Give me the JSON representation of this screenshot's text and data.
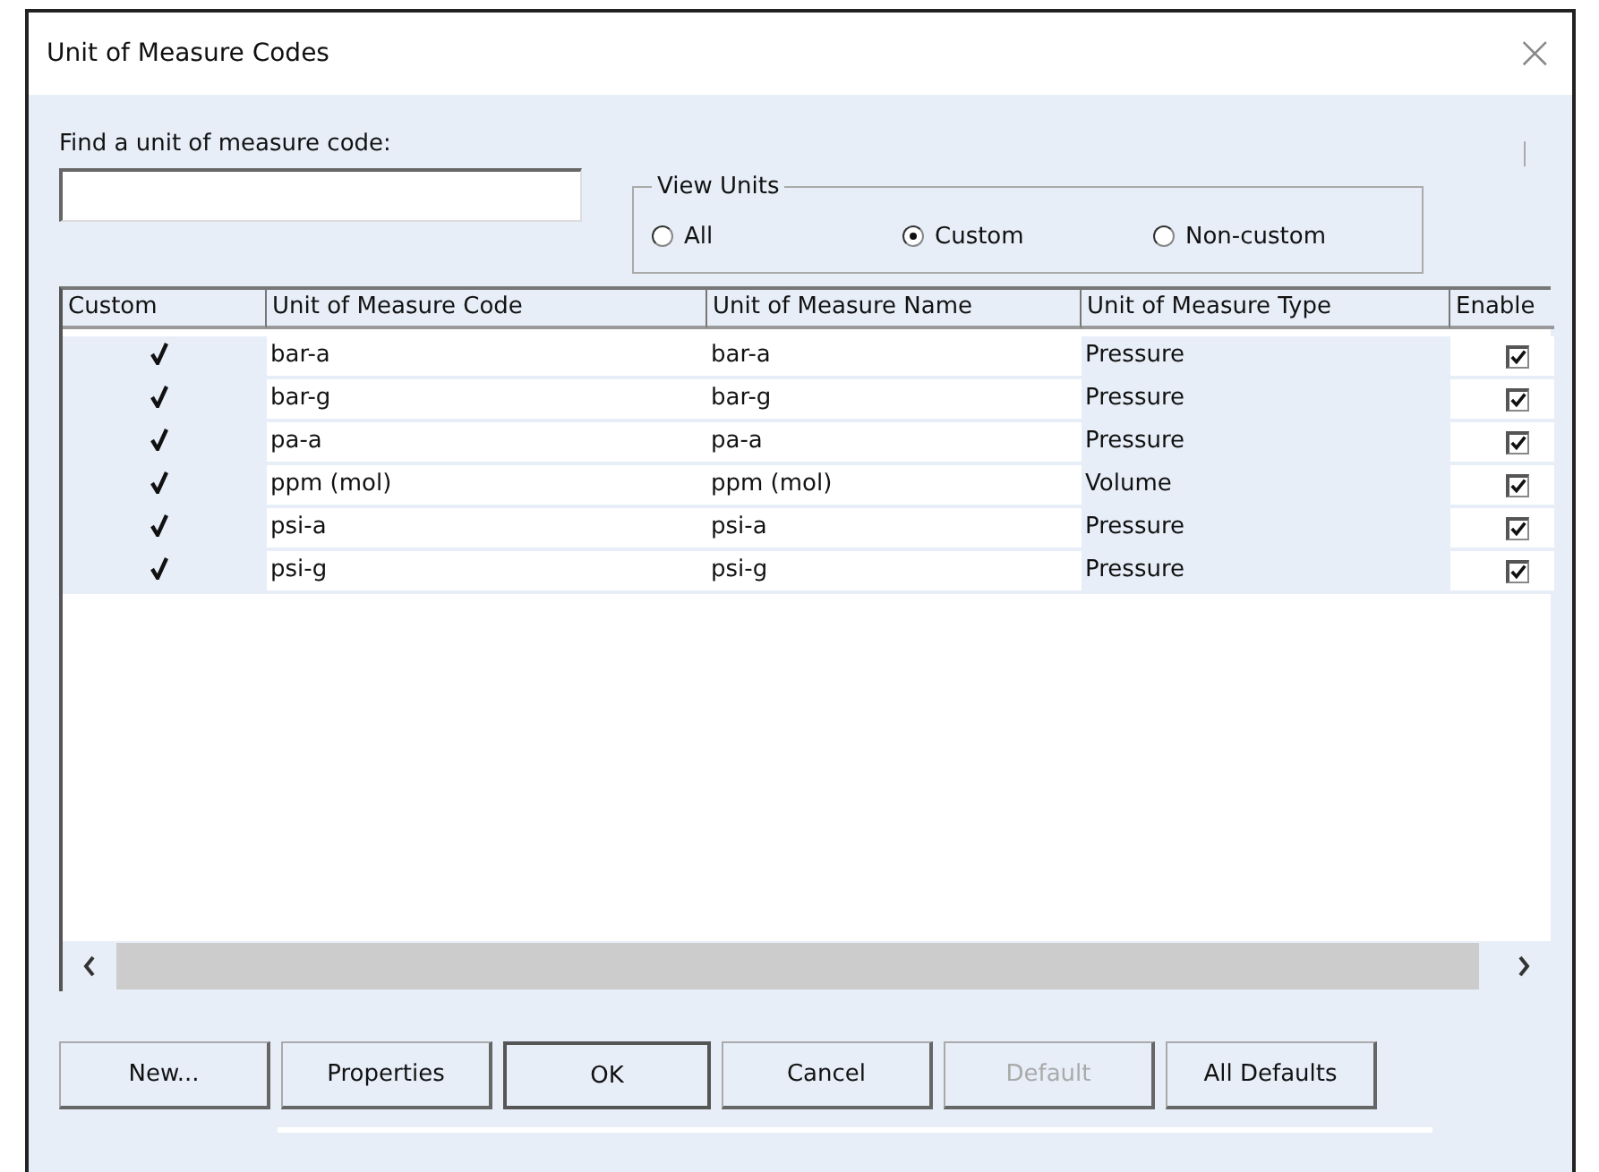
{
  "window": {
    "title": "Unit of Measure Codes",
    "close": "×"
  },
  "search": {
    "label": "Find a unit of measure code:"
  },
  "view_units": {
    "label": "View Units",
    "options": [
      {
        "label": "All",
        "selected": false
      },
      {
        "label": "Custom",
        "selected": true
      },
      {
        "label": "Non-custom",
        "selected": false
      }
    ]
  },
  "table": {
    "columns": [
      "Custom",
      "Unit of Measure Code",
      "Unit of Measure Name",
      "Unit of Measure Type",
      "Enable"
    ],
    "rows": [
      {
        "custom": true,
        "code": "bar-a",
        "name": "bar-a",
        "type": "Pressure",
        "enabled": true
      },
      {
        "custom": true,
        "code": "bar-g",
        "name": "bar-g",
        "type": "Pressure",
        "enabled": true
      },
      {
        "custom": true,
        "code": "pa-a",
        "name": "pa-a",
        "type": "Pressure",
        "enabled": true
      },
      {
        "custom": true,
        "code": "ppm (mol)",
        "name": "ppm (mol)",
        "type": "Volume",
        "enabled": true
      },
      {
        "custom": true,
        "code": "psi-a",
        "name": "psi-a",
        "type": "Pressure",
        "enabled": true
      },
      {
        "custom": true,
        "code": "psi-g",
        "name": "psi-g",
        "type": "Pressure",
        "enabled": true
      }
    ]
  },
  "buttons": [
    {
      "label": "New...",
      "disabled": false,
      "default": false
    },
    {
      "label": "Properties",
      "disabled": false,
      "default": false
    },
    {
      "label": "OK",
      "disabled": false,
      "default": true
    },
    {
      "label": "Cancel",
      "disabled": false,
      "default": false
    },
    {
      "label": "Default",
      "disabled": true,
      "default": false
    },
    {
      "label": "All Defaults",
      "disabled": false,
      "default": false
    }
  ]
}
